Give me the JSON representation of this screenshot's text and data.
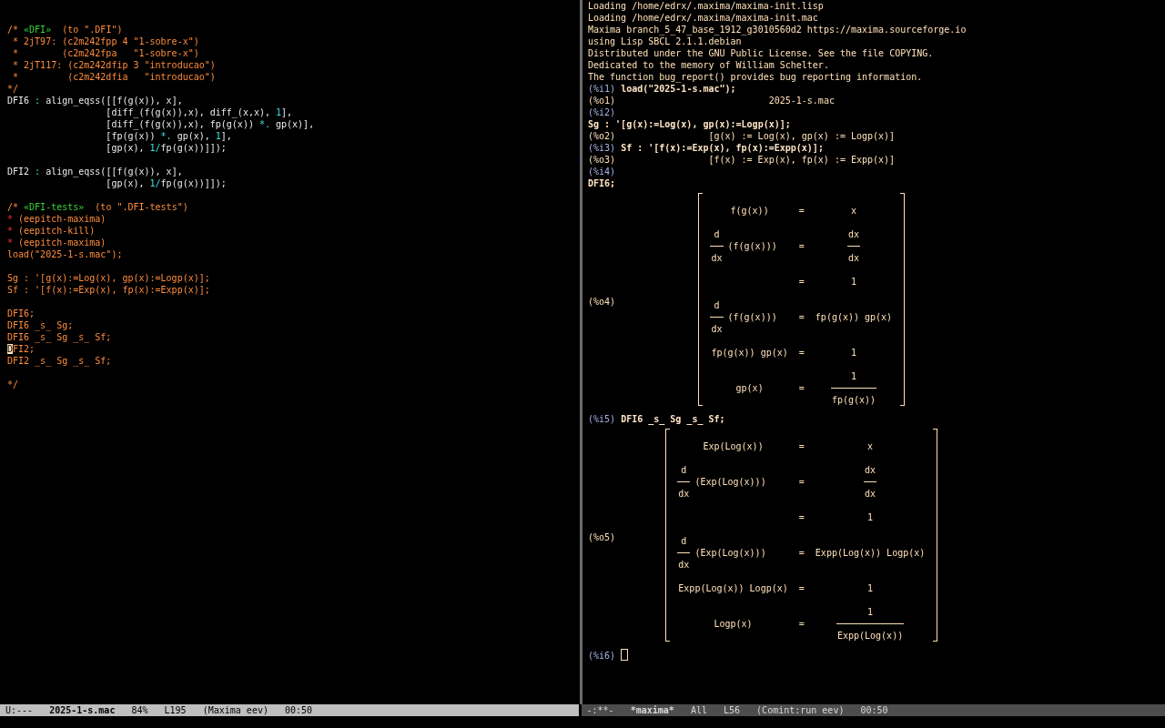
{
  "editor": {
    "lines": [
      {
        "kind": "blank"
      },
      {
        "kind": "blank"
      },
      {
        "kind": "text",
        "segments": [
          {
            "text": "/* ",
            "kind": "comment"
          },
          {
            "text": "«DFI»",
            "kind": "anchor"
          },
          {
            "text": "  (to \".DFI\")",
            "kind": "comment"
          }
        ]
      },
      {
        "kind": "text",
        "segments": [
          {
            "text": " * 2jT97: (c2m242fpp 4 \"1-sobre-x\")",
            "kind": "comment"
          }
        ]
      },
      {
        "kind": "text",
        "segments": [
          {
            "text": " *        (c2m242fpa   \"1-sobre-x\")",
            "kind": "comment"
          }
        ]
      },
      {
        "kind": "text",
        "segments": [
          {
            "text": " * 2jT117: (c2m242dfip 3 \"introducao\")",
            "kind": "comment"
          }
        ]
      },
      {
        "kind": "text",
        "segments": [
          {
            "text": " *         (c2m242dfia   \"introducao\")",
            "kind": "comment"
          }
        ]
      },
      {
        "kind": "text",
        "segments": [
          {
            "text": "*/",
            "kind": "comment"
          }
        ]
      },
      {
        "kind": "text",
        "segments": [
          {
            "text": "DFI6 ",
            "kind": "code"
          },
          {
            "text": ":",
            "kind": "op"
          },
          {
            "text": " align_eqss([[f(g(x)), x],",
            "kind": "code"
          }
        ]
      },
      {
        "kind": "text",
        "segments": [
          {
            "text": "                  [diff_(f(g(x)),x), diff_(x,x), ",
            "kind": "code"
          },
          {
            "text": "1",
            "kind": "op"
          },
          {
            "text": "],",
            "kind": "code"
          }
        ]
      },
      {
        "kind": "text",
        "segments": [
          {
            "text": "                  [diff_(f(g(x)),x), fp(g(x)) ",
            "kind": "code"
          },
          {
            "text": "*.",
            "kind": "op"
          },
          {
            "text": " gp(x)],",
            "kind": "code"
          }
        ]
      },
      {
        "kind": "text",
        "segments": [
          {
            "text": "                  [fp(g(x)) ",
            "kind": "code"
          },
          {
            "text": "*.",
            "kind": "op"
          },
          {
            "text": " gp(x), ",
            "kind": "code"
          },
          {
            "text": "1",
            "kind": "op"
          },
          {
            "text": "],",
            "kind": "code"
          }
        ]
      },
      {
        "kind": "text",
        "segments": [
          {
            "text": "                  [gp(x), ",
            "kind": "code"
          },
          {
            "text": "1/",
            "kind": "op"
          },
          {
            "text": "fp(g(x))]]);",
            "kind": "code"
          }
        ]
      },
      {
        "kind": "blank"
      },
      {
        "kind": "text",
        "segments": [
          {
            "text": "DFI2 ",
            "kind": "code"
          },
          {
            "text": ":",
            "kind": "op"
          },
          {
            "text": " align_eqss([[f(g(x)), x],",
            "kind": "code"
          }
        ]
      },
      {
        "kind": "text",
        "segments": [
          {
            "text": "                  [gp(x), ",
            "kind": "code"
          },
          {
            "text": "1/",
            "kind": "op"
          },
          {
            "text": "fp(g(x))]]);",
            "kind": "code"
          }
        ]
      },
      {
        "kind": "blank"
      },
      {
        "kind": "text",
        "segments": [
          {
            "text": "/* ",
            "kind": "comment"
          },
          {
            "text": "«DFI-tests»",
            "kind": "anchor"
          },
          {
            "text": "  (to \".DFI-tests\")",
            "kind": "comment"
          }
        ]
      },
      {
        "kind": "text",
        "segments": [
          {
            "text": "*",
            "kind": "star"
          },
          {
            "text": " (eepitch-maxima)",
            "kind": "comment"
          }
        ]
      },
      {
        "kind": "text",
        "segments": [
          {
            "text": "*",
            "kind": "star"
          },
          {
            "text": " (eepitch-kill)",
            "kind": "comment"
          }
        ]
      },
      {
        "kind": "text",
        "segments": [
          {
            "text": "*",
            "kind": "star"
          },
          {
            "text": " (eepitch-maxima)",
            "kind": "comment"
          }
        ]
      },
      {
        "kind": "text",
        "segments": [
          {
            "text": "load(\"2025-1-s.mac\");",
            "kind": "comment"
          }
        ]
      },
      {
        "kind": "blank"
      },
      {
        "kind": "text",
        "segments": [
          {
            "text": "Sg : '[g(x):=Log(x), gp(x):=Logp(x)];",
            "kind": "comment"
          }
        ]
      },
      {
        "kind": "text",
        "segments": [
          {
            "text": "Sf : '[f(x):=Exp(x), fp(x):=Expp(x)];",
            "kind": "comment"
          }
        ]
      },
      {
        "kind": "blank"
      },
      {
        "kind": "text",
        "segments": [
          {
            "text": "DFI6;",
            "kind": "comment"
          }
        ]
      },
      {
        "kind": "text",
        "segments": [
          {
            "text": "DFI6 _s_ Sg;",
            "kind": "comment"
          }
        ]
      },
      {
        "kind": "text",
        "segments": [
          {
            "text": "DFI6 _s_ Sg _s_ Sf;",
            "kind": "comment"
          }
        ]
      },
      {
        "kind": "text",
        "segments": [
          {
            "text": "D",
            "kind": "cursor"
          },
          {
            "text": "FI2;",
            "kind": "comment"
          }
        ]
      },
      {
        "kind": "text",
        "segments": [
          {
            "text": "DFI2 _s_ Sg _s_ Sf;",
            "kind": "comment"
          }
        ]
      },
      {
        "kind": "blank"
      },
      {
        "kind": "text",
        "segments": [
          {
            "text": "*/",
            "kind": "comment"
          }
        ]
      }
    ]
  },
  "console": {
    "entries": [
      {
        "kind": "text",
        "text": "Loading /home/edrx/.maxima/maxima-init.lisp"
      },
      {
        "kind": "text",
        "text": "Loading /home/edrx/.maxima/maxima-init.mac"
      },
      {
        "kind": "text",
        "text": "Maxima branch_5_47_base_1912_g3010560d2 https://maxima.sourceforge.io"
      },
      {
        "kind": "text",
        "text": "using Lisp SBCL 2.1.1.debian"
      },
      {
        "kind": "text",
        "text": "Distributed under the GNU Public License. See the file COPYING."
      },
      {
        "kind": "text",
        "text": "Dedicated to the memory of William Schelter."
      },
      {
        "kind": "text",
        "text": "The function bug_report() provides bug reporting information."
      },
      {
        "kind": "input",
        "label": "(%i1)",
        "text": "load(\"2025-1-s.mac\");"
      },
      {
        "kind": "output",
        "label": "(%o1)",
        "text": "2025-1-s.mac"
      },
      {
        "kind": "input",
        "label": "(%i2)"
      },
      {
        "kind": "input",
        "text": "Sg : '[g(x):=Log(x), gp(x):=Logp(x)];"
      },
      {
        "kind": "output",
        "label": "(%o2)",
        "text": "[g(x) := Log(x), gp(x) := Logp(x)]"
      },
      {
        "kind": "input",
        "label": "(%i3)",
        "text": "Sf : '[f(x):=Exp(x), fp(x):=Expp(x)];"
      },
      {
        "kind": "output",
        "label": "(%o3)",
        "text": "[f(x) := Exp(x), fp(x) := Expp(x)]"
      },
      {
        "kind": "input",
        "label": "(%i4)"
      },
      {
        "kind": "input",
        "text": "DFI6;"
      },
      {
        "kind": "matrix",
        "label": "(%o4)",
        "rows": [
          {
            "lhs": {
              "kind": "text",
              "text": "f(g(x))"
            },
            "op": "=",
            "rhs": {
              "kind": "text",
              "text": "x"
            }
          },
          {
            "lhs": {
              "kind": "derivative",
              "num": "d",
              "den": "dx",
              "arg": "(f(g(x)))"
            },
            "op": "=",
            "rhs": {
              "kind": "fraction",
              "num": "dx",
              "den": "dx"
            }
          },
          {
            "op": "=",
            "rhs": {
              "kind": "text",
              "text": "1"
            }
          },
          {
            "lhs": {
              "kind": "derivative",
              "num": "d",
              "den": "dx",
              "arg": "(f(g(x)))"
            },
            "op": "=",
            "rhs": {
              "kind": "text",
              "text": "fp(g(x)) gp(x)"
            }
          },
          {
            "lhs": {
              "kind": "text",
              "text": "fp(g(x)) gp(x)"
            },
            "op": "=",
            "rhs": {
              "kind": "text",
              "text": "1"
            }
          },
          {
            "lhs": {
              "kind": "text",
              "text": "gp(x)"
            },
            "op": "=",
            "rhs": {
              "kind": "fraction",
              "num": "1",
              "den": "fp(g(x))"
            }
          }
        ]
      },
      {
        "kind": "input",
        "label": "(%i5)",
        "text": "DFI6 _s_ Sg _s_ Sf;"
      },
      {
        "kind": "matrix",
        "label": "(%o5)",
        "rows": [
          {
            "lhs": {
              "kind": "text",
              "text": "Exp(Log(x))"
            },
            "op": "=",
            "rhs": {
              "kind": "text",
              "text": "x"
            }
          },
          {
            "lhs": {
              "kind": "derivative",
              "num": "d",
              "den": "dx",
              "arg": "(Exp(Log(x)))"
            },
            "op": "=",
            "rhs": {
              "kind": "fraction",
              "num": "dx",
              "den": "dx"
            }
          },
          {
            "op": "=",
            "rhs": {
              "kind": "text",
              "text": "1"
            }
          },
          {
            "lhs": {
              "kind": "derivative",
              "num": "d",
              "den": "dx",
              "arg": "(Exp(Log(x)))"
            },
            "op": "=",
            "rhs": {
              "kind": "text",
              "text": "Expp(Log(x)) Logp(x)"
            }
          },
          {
            "lhs": {
              "kind": "text",
              "text": "Expp(Log(x)) Logp(x)"
            },
            "op": "=",
            "rhs": {
              "kind": "text",
              "text": "1"
            }
          },
          {
            "lhs": {
              "kind": "text",
              "text": "Logp(x)"
            },
            "op": "=",
            "rhs": {
              "kind": "fraction",
              "num": "1",
              "den": "Expp(Log(x))"
            }
          }
        ]
      },
      {
        "kind": "input",
        "label": "(%i6)",
        "cursor": true
      }
    ]
  },
  "mode_lines": [
    {
      "active": true,
      "items": [
        {
          "text": "U:---",
          "kind": "status"
        },
        {
          "text": "2025-1-s.mac",
          "kind": "buffer"
        },
        {
          "text": "84%",
          "kind": "info"
        },
        {
          "text": "L195",
          "kind": "info"
        },
        {
          "text": "(Maxima eev)",
          "kind": "info"
        },
        {
          "text": "00:50",
          "kind": "info"
        }
      ]
    },
    {
      "active": false,
      "items": [
        {
          "text": "-:**-",
          "kind": "status"
        },
        {
          "text": "*maxima*",
          "kind": "buffer"
        },
        {
          "text": "All",
          "kind": "info"
        },
        {
          "text": "L56",
          "kind": "info"
        },
        {
          "text": "(Comint:run eev)",
          "kind": "info"
        },
        {
          "text": "00:50",
          "kind": "info"
        }
      ]
    }
  ]
}
